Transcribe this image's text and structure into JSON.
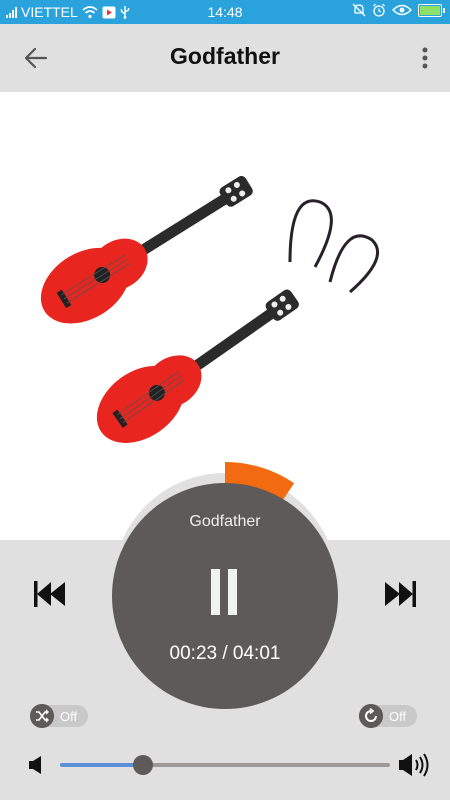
{
  "status_bar": {
    "carrier": "VIETTEL",
    "time": "14:48",
    "icons": [
      "signal-icon",
      "wifi-icon",
      "screen-record-icon",
      "usb-icon",
      "alarm-off-icon",
      "alarm-clock-icon",
      "eye-icon",
      "battery-charging-icon"
    ]
  },
  "app_bar": {
    "title": "Godfather",
    "back_icon": "arrow-left-icon",
    "menu_icon": "more-vertical-icon"
  },
  "artwork": {
    "description_icon": "album-art-guitar-earrings"
  },
  "player": {
    "track_title": "Godfather",
    "time_display": "00:23 / 04:01",
    "progress_fraction": 0.095,
    "state_icon": "pause-icon",
    "accent_color": "#f26b10"
  },
  "controls": {
    "prev_icon": "skip-previous-icon",
    "next_icon": "skip-next-icon",
    "shuffle": {
      "icon": "shuffle-icon",
      "label": "Off"
    },
    "repeat": {
      "icon": "repeat-icon",
      "label": "Off"
    }
  },
  "volume": {
    "level_fraction": 0.25,
    "low_icon": "volume-low-icon",
    "high_icon": "volume-high-icon",
    "fill_color": "#5b8fd6"
  }
}
